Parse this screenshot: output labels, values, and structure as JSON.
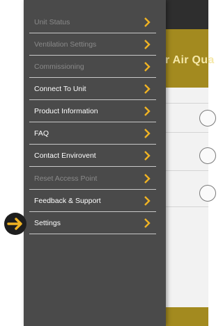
{
  "app": {
    "banner_title": "r Air Qua"
  },
  "drawer": {
    "items": [
      {
        "label": "Unit Status",
        "enabled": false
      },
      {
        "label": "Ventilation Settings",
        "enabled": false
      },
      {
        "label": "Commissioning",
        "enabled": false
      },
      {
        "label": "Connect To Unit",
        "enabled": true
      },
      {
        "label": "Product Information",
        "enabled": true
      },
      {
        "label": "FAQ",
        "enabled": true
      },
      {
        "label": "Contact Envirovent",
        "enabled": true
      },
      {
        "label": "Reset Access Point",
        "enabled": false
      },
      {
        "label": "Feedback & Support",
        "enabled": true
      },
      {
        "label": "Settings",
        "enabled": true
      }
    ]
  },
  "pointer": {
    "target": "Settings",
    "icon": "arrow-right-icon"
  },
  "colors": {
    "drawer_bg": "#4a4a4a",
    "chevron": "#f0b323",
    "banner": "#a38a1f",
    "disabled_text": "#8a8a8a"
  }
}
